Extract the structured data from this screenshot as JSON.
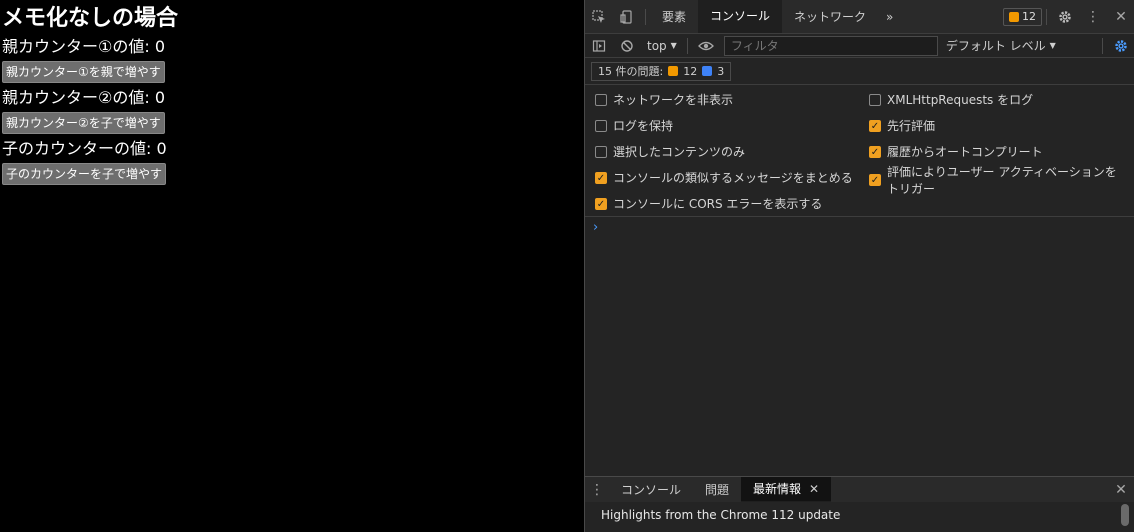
{
  "app": {
    "title": "メモ化なしの場合",
    "parent1_label": "親カウンター①の値: 0",
    "parent1_button": "親カウンター①を親で増やす",
    "parent2_label": "親カウンター②の値: 0",
    "parent2_button": "親カウンター②を子で増やす",
    "child_label": "子のカウンターの値: 0",
    "child_button": "子のカウンターを子で増やす"
  },
  "devtools": {
    "tabs": [
      "要素",
      "コンソール",
      "ネットワーク"
    ],
    "more": "»",
    "issue_badge_count": "12",
    "context": "top",
    "filter_placeholder": "フィルタ",
    "level": "デフォルト レベル",
    "issues_label": "15 件の問題:",
    "issues_warn": "12",
    "issues_info": "3",
    "settings_left": [
      {
        "label": "ネットワークを非表示",
        "checked": false
      },
      {
        "label": "ログを保持",
        "checked": false
      },
      {
        "label": "選択したコンテンツのみ",
        "checked": false
      },
      {
        "label": "コンソールの類似するメッセージをまとめる",
        "checked": true
      },
      {
        "label": "コンソールに CORS エラーを表示する",
        "checked": true
      }
    ],
    "settings_right": [
      {
        "label": "XMLHttpRequests をログ",
        "checked": false
      },
      {
        "label": "先行評価",
        "checked": true
      },
      {
        "label": "履歴からオートコンプリート",
        "checked": true
      },
      {
        "label": "評価によりユーザー アクティベーションを\nトリガー",
        "checked": true
      }
    ],
    "prompt": "›",
    "drawer_tabs": [
      "コンソール",
      "問題",
      "最新情報"
    ],
    "drawer_content": "Highlights from the Chrome 112 update",
    "colors": {
      "accent": "#f0a020",
      "link": "#4a9cff"
    }
  }
}
